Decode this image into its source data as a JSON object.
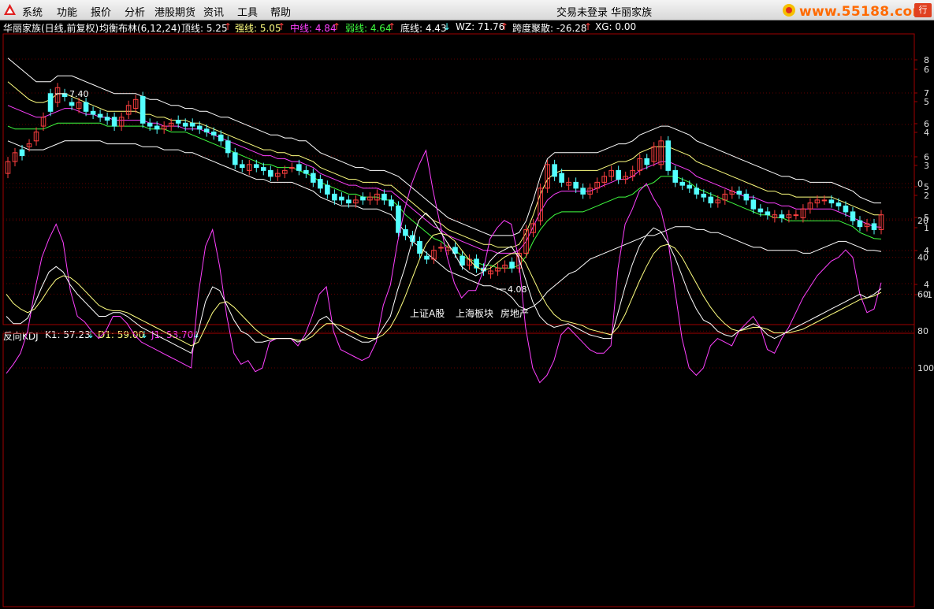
{
  "menu": {
    "items": [
      "系统",
      "功能",
      "报价",
      "分析",
      "港股期货",
      "资讯",
      "工具",
      "帮助"
    ],
    "title": "交易未登录  华丽家族",
    "site": "www.55188.com",
    "corner": "行"
  },
  "main_header": {
    "name": "华丽家族(日线,前复权)",
    "indicator": "均衡布林(6,12,24)",
    "top_label": "顶线: 5.25",
    "strong_label": "强线: 5.05",
    "mid_label": "中线: 4.84",
    "weak_label": "弱线: 4.64",
    "bottom_label": "底线: 4.43",
    "wz_label": "WZ: 71.76",
    "span_label": "跨度聚散: -26.28",
    "xg_label": "XG: 0.00",
    "up_arrow": "↑",
    "down_arrow": "↓"
  },
  "kdj_header": {
    "name": "反向KDJ",
    "k_label": "K1: 57.23",
    "d_label": "D1: 59.00",
    "j_label": "J1: 53.70"
  },
  "annotations": {
    "high": "7.40",
    "low": "4.08"
  },
  "sector_labels": [
    "上证A股",
    "上海板块",
    "房地产"
  ],
  "price_axis_labels": [
    "8",
    "6",
    "7",
    "5",
    "6",
    "4",
    "6",
    "3",
    "5",
    "2",
    "5",
    "1",
    "4",
    "4",
    "-1"
  ],
  "kdj_axis_labels": [
    "100",
    "80",
    "60",
    "40",
    "20",
    "0"
  ],
  "colors": {
    "up": "#ff4040",
    "down": "#54ffff",
    "top": "#ffffff",
    "strong": "#ffff80",
    "mid": "#ff40ff",
    "weak": "#40ff40",
    "bottom": "#ffffff",
    "k": "#ffffff",
    "d": "#ffff80",
    "j": "#ff40ff",
    "frame": "#a00000"
  },
  "chart_data": {
    "type": "candlestick+kdj",
    "price": {
      "close": [
        5.95,
        6.1,
        6.05,
        6.25,
        6.45,
        6.7,
        6.8,
        7.2,
        7.05,
        6.9,
        6.95,
        6.8,
        6.75,
        6.7,
        6.65,
        6.55,
        6.7,
        6.9,
        7.0,
        6.6,
        6.55,
        6.5,
        6.55,
        6.6,
        6.6,
        6.55,
        6.55,
        6.5,
        6.45,
        6.4,
        6.3,
        6.1,
        5.9,
        5.85,
        5.9,
        5.85,
        5.8,
        5.7,
        5.75,
        5.8,
        5.85,
        5.8,
        5.75,
        5.6,
        5.5,
        5.4,
        5.3,
        5.3,
        5.25,
        5.3,
        5.3,
        5.35,
        5.4,
        5.3,
        5.2,
        4.75,
        4.7,
        4.6,
        4.4,
        4.3,
        4.45,
        4.5,
        4.5,
        4.4,
        4.2,
        4.3,
        4.15,
        4.1,
        4.1,
        4.15,
        4.2,
        4.15,
        4.4,
        4.8,
        4.9,
        5.5,
        5.9,
        5.7,
        5.6,
        5.6,
        5.5,
        5.4,
        5.5,
        5.6,
        5.7,
        5.8,
        5.65,
        5.7,
        5.8,
        6.0,
        5.9,
        6.2,
        6.3,
        5.8,
        5.6,
        5.55,
        5.5,
        5.4,
        5.35,
        5.25,
        5.3,
        5.4,
        5.45,
        5.4,
        5.3,
        5.15,
        5.1,
        5.05,
        5.05,
        5.0,
        5.05,
        5.05,
        5.15,
        5.25,
        5.3,
        5.3,
        5.25,
        5.2,
        5.1,
        4.95,
        4.85,
        4.9,
        4.8,
        5.05
      ],
      "open": [
        5.75,
        5.95,
        6.15,
        6.2,
        6.3,
        6.55,
        7.1,
        6.95,
        7.1,
        6.95,
        6.85,
        6.95,
        6.8,
        6.75,
        6.7,
        6.7,
        6.55,
        6.75,
        6.85,
        7.05,
        6.6,
        6.55,
        6.5,
        6.55,
        6.65,
        6.6,
        6.6,
        6.55,
        6.5,
        6.45,
        6.4,
        6.3,
        6.1,
        5.9,
        5.8,
        5.9,
        5.85,
        5.8,
        5.7,
        5.75,
        5.85,
        5.9,
        5.8,
        5.75,
        5.65,
        5.55,
        5.4,
        5.35,
        5.3,
        5.25,
        5.35,
        5.3,
        5.3,
        5.4,
        5.3,
        5.2,
        4.8,
        4.7,
        4.6,
        4.35,
        4.3,
        4.5,
        4.45,
        4.5,
        4.35,
        4.2,
        4.3,
        4.15,
        4.05,
        4.1,
        4.15,
        4.25,
        4.15,
        4.4,
        4.75,
        4.95,
        5.5,
        5.9,
        5.75,
        5.55,
        5.6,
        5.5,
        5.4,
        5.5,
        5.6,
        5.7,
        5.8,
        5.65,
        5.7,
        5.8,
        6.0,
        5.95,
        5.9,
        6.3,
        5.8,
        5.6,
        5.55,
        5.5,
        5.4,
        5.35,
        5.25,
        5.3,
        5.4,
        5.45,
        5.4,
        5.3,
        5.15,
        5.1,
        5.0,
        5.05,
        5.0,
        5.05,
        5.0,
        5.15,
        5.25,
        5.3,
        5.3,
        5.25,
        5.2,
        5.1,
        4.95,
        4.85,
        4.9,
        4.8
      ],
      "bands": {
        "top": [
          7.7,
          7.6,
          7.5,
          7.4,
          7.3,
          7.3,
          7.3,
          7.4,
          7.4,
          7.4,
          7.35,
          7.3,
          7.25,
          7.2,
          7.15,
          7.1,
          7.1,
          7.1,
          7.1,
          7.05,
          7.0,
          7.0,
          6.95,
          6.9,
          6.9,
          6.85,
          6.85,
          6.8,
          6.8,
          6.75,
          6.7,
          6.7,
          6.65,
          6.6,
          6.55,
          6.5,
          6.45,
          6.4,
          6.4,
          6.35,
          6.35,
          6.3,
          6.3,
          6.2,
          6.1,
          6.05,
          6.0,
          5.95,
          5.9,
          5.85,
          5.85,
          5.8,
          5.8,
          5.8,
          5.75,
          5.7,
          5.6,
          5.5,
          5.4,
          5.3,
          5.2,
          5.1,
          5.0,
          4.95,
          4.9,
          4.85,
          4.8,
          4.75,
          4.7,
          4.7,
          4.7,
          4.7,
          4.75,
          4.95,
          5.3,
          5.7,
          6.0,
          6.1,
          6.1,
          6.1,
          6.1,
          6.1,
          6.1,
          6.1,
          6.15,
          6.2,
          6.25,
          6.25,
          6.3,
          6.4,
          6.45,
          6.5,
          6.55,
          6.55,
          6.5,
          6.45,
          6.4,
          6.3,
          6.25,
          6.2,
          6.15,
          6.1,
          6.05,
          6.0,
          5.95,
          5.9,
          5.85,
          5.8,
          5.75,
          5.7,
          5.7,
          5.65,
          5.65,
          5.6,
          5.6,
          5.6,
          5.6,
          5.55,
          5.5,
          5.45,
          5.35,
          5.3,
          5.25,
          5.25
        ],
        "strong": [
          7.3,
          7.2,
          7.1,
          7.0,
          6.95,
          6.95,
          7.0,
          7.1,
          7.1,
          7.05,
          7.0,
          6.95,
          6.9,
          6.85,
          6.8,
          6.8,
          6.8,
          6.8,
          6.8,
          6.75,
          6.75,
          6.7,
          6.7,
          6.65,
          6.65,
          6.65,
          6.6,
          6.6,
          6.55,
          6.5,
          6.45,
          6.4,
          6.35,
          6.3,
          6.25,
          6.2,
          6.15,
          6.15,
          6.1,
          6.1,
          6.05,
          6.05,
          6.0,
          5.95,
          5.85,
          5.8,
          5.75,
          5.7,
          5.65,
          5.65,
          5.6,
          5.6,
          5.6,
          5.55,
          5.55,
          5.45,
          5.35,
          5.25,
          5.15,
          5.05,
          4.95,
          4.9,
          4.8,
          4.75,
          4.7,
          4.65,
          4.6,
          4.55,
          4.55,
          4.5,
          4.5,
          4.5,
          4.55,
          4.75,
          5.05,
          5.4,
          5.65,
          5.75,
          5.8,
          5.8,
          5.8,
          5.8,
          5.8,
          5.8,
          5.85,
          5.9,
          5.95,
          5.95,
          6.0,
          6.1,
          6.15,
          6.2,
          6.2,
          6.2,
          6.15,
          6.1,
          6.05,
          5.95,
          5.9,
          5.85,
          5.8,
          5.75,
          5.7,
          5.65,
          5.6,
          5.55,
          5.5,
          5.45,
          5.45,
          5.4,
          5.4,
          5.35,
          5.35,
          5.35,
          5.35,
          5.35,
          5.35,
          5.3,
          5.25,
          5.2,
          5.15,
          5.1,
          5.05,
          5.05
        ],
        "mid": [
          6.9,
          6.85,
          6.8,
          6.75,
          6.7,
          6.7,
          6.75,
          6.8,
          6.85,
          6.85,
          6.8,
          6.75,
          6.75,
          6.7,
          6.7,
          6.65,
          6.65,
          6.65,
          6.65,
          6.65,
          6.6,
          6.6,
          6.55,
          6.55,
          6.55,
          6.5,
          6.5,
          6.5,
          6.45,
          6.4,
          6.35,
          6.3,
          6.25,
          6.2,
          6.15,
          6.1,
          6.05,
          6.05,
          6.0,
          6.0,
          5.95,
          5.95,
          5.9,
          5.85,
          5.75,
          5.7,
          5.65,
          5.6,
          5.55,
          5.55,
          5.5,
          5.5,
          5.5,
          5.45,
          5.45,
          5.35,
          5.25,
          5.15,
          5.05,
          4.95,
          4.85,
          4.8,
          4.7,
          4.65,
          4.6,
          4.55,
          4.5,
          4.45,
          4.45,
          4.4,
          4.4,
          4.4,
          4.45,
          4.6,
          4.85,
          5.1,
          5.3,
          5.4,
          5.45,
          5.45,
          5.45,
          5.45,
          5.45,
          5.5,
          5.55,
          5.6,
          5.65,
          5.65,
          5.7,
          5.8,
          5.85,
          5.9,
          5.95,
          5.95,
          5.9,
          5.85,
          5.8,
          5.7,
          5.65,
          5.6,
          5.55,
          5.5,
          5.45,
          5.4,
          5.35,
          5.35,
          5.3,
          5.25,
          5.25,
          5.2,
          5.2,
          5.15,
          5.15,
          5.15,
          5.15,
          5.15,
          5.15,
          5.1,
          5.05,
          5.0,
          4.95,
          4.9,
          4.85,
          4.84
        ],
        "weak": [
          6.55,
          6.5,
          6.5,
          6.5,
          6.5,
          6.5,
          6.55,
          6.6,
          6.6,
          6.6,
          6.6,
          6.6,
          6.6,
          6.6,
          6.55,
          6.55,
          6.55,
          6.55,
          6.55,
          6.55,
          6.5,
          6.5,
          6.5,
          6.45,
          6.45,
          6.45,
          6.4,
          6.35,
          6.3,
          6.25,
          6.2,
          6.15,
          6.1,
          6.05,
          6.0,
          5.95,
          5.9,
          5.9,
          5.85,
          5.85,
          5.85,
          5.8,
          5.75,
          5.7,
          5.6,
          5.55,
          5.5,
          5.45,
          5.4,
          5.4,
          5.35,
          5.35,
          5.35,
          5.3,
          5.3,
          5.2,
          5.05,
          4.95,
          4.85,
          4.75,
          4.65,
          4.6,
          4.5,
          4.45,
          4.35,
          4.3,
          4.25,
          4.2,
          4.2,
          4.15,
          4.15,
          4.15,
          4.2,
          4.35,
          4.6,
          4.8,
          4.95,
          5.05,
          5.1,
          5.1,
          5.1,
          5.1,
          5.15,
          5.2,
          5.25,
          5.3,
          5.35,
          5.35,
          5.4,
          5.5,
          5.55,
          5.6,
          5.7,
          5.7,
          5.7,
          5.65,
          5.6,
          5.5,
          5.45,
          5.4,
          5.35,
          5.3,
          5.25,
          5.2,
          5.15,
          5.1,
          5.05,
          5.05,
          5.0,
          5.0,
          4.95,
          4.95,
          4.95,
          4.95,
          4.95,
          4.95,
          4.95,
          4.95,
          4.9,
          4.85,
          4.75,
          4.7,
          4.65,
          4.64
        ],
        "bottom": [
          6.3,
          6.25,
          6.2,
          6.15,
          6.15,
          6.15,
          6.2,
          6.25,
          6.3,
          6.3,
          6.3,
          6.3,
          6.3,
          6.3,
          6.25,
          6.25,
          6.25,
          6.25,
          6.25,
          6.2,
          6.2,
          6.2,
          6.15,
          6.15,
          6.15,
          6.1,
          6.1,
          6.05,
          6.0,
          5.95,
          5.9,
          5.85,
          5.8,
          5.75,
          5.7,
          5.65,
          5.65,
          5.6,
          5.6,
          5.6,
          5.6,
          5.55,
          5.5,
          5.45,
          5.35,
          5.3,
          5.25,
          5.2,
          5.2,
          5.2,
          5.15,
          5.15,
          5.15,
          5.1,
          5.05,
          4.9,
          4.75,
          4.6,
          4.5,
          4.4,
          4.3,
          4.2,
          4.1,
          4.05,
          4.0,
          3.95,
          3.9,
          3.85,
          3.85,
          3.8,
          3.75,
          3.65,
          3.5,
          3.45,
          3.5,
          3.6,
          3.75,
          3.85,
          3.95,
          4.05,
          4.1,
          4.2,
          4.3,
          4.35,
          4.4,
          4.45,
          4.5,
          4.55,
          4.6,
          4.65,
          4.7,
          4.7,
          4.75,
          4.8,
          4.85,
          4.85,
          4.85,
          4.8,
          4.8,
          4.75,
          4.75,
          4.7,
          4.65,
          4.6,
          4.55,
          4.5,
          4.5,
          4.45,
          4.45,
          4.45,
          4.45,
          4.45,
          4.4,
          4.4,
          4.45,
          4.5,
          4.55,
          4.6,
          4.6,
          4.55,
          4.5,
          4.45,
          4.45,
          4.43
        ]
      },
      "y_range": [
        3.3,
        7.95
      ]
    },
    "kdj": {
      "k": [
        72,
        76,
        76,
        73,
        65,
        56,
        48,
        45,
        48,
        55,
        60,
        64,
        68,
        72,
        72,
        70,
        70,
        72,
        75,
        78,
        80,
        82,
        84,
        86,
        88,
        90,
        92,
        80,
        64,
        56,
        58,
        66,
        74,
        80,
        82,
        86,
        86,
        85,
        84,
        84,
        84,
        86,
        84,
        80,
        74,
        72,
        76,
        80,
        82,
        84,
        86,
        86,
        84,
        78,
        72,
        58,
        46,
        32,
        20,
        16,
        20,
        26,
        32,
        38,
        45,
        48,
        50,
        48,
        42,
        38,
        36,
        34,
        40,
        52,
        64,
        72,
        76,
        78,
        77,
        76,
        78,
        80,
        82,
        83,
        84,
        84,
        70,
        56,
        44,
        34,
        28,
        24,
        26,
        32,
        40,
        50,
        60,
        68,
        74,
        76,
        80,
        82,
        83,
        80,
        78,
        76,
        78,
        82,
        84,
        82,
        80,
        78,
        76,
        74,
        72,
        70,
        68,
        66,
        64,
        62,
        60,
        62,
        60,
        57
      ],
      "d": [
        60,
        65,
        68,
        70,
        68,
        63,
        57,
        52,
        50,
        51,
        54,
        58,
        62,
        66,
        68,
        69,
        69,
        70,
        72,
        74,
        76,
        78,
        80,
        82,
        84,
        86,
        88,
        86,
        78,
        70,
        65,
        64,
        67,
        71,
        75,
        79,
        82,
        84,
        84,
        84,
        84,
        85,
        85,
        83,
        79,
        76,
        76,
        77,
        79,
        81,
        83,
        84,
        84,
        82,
        78,
        71,
        62,
        52,
        42,
        33,
        28,
        27,
        28,
        31,
        36,
        41,
        45,
        47,
        46,
        43,
        40,
        38,
        38,
        43,
        51,
        59,
        66,
        71,
        74,
        75,
        76,
        77,
        79,
        80,
        81,
        82,
        78,
        71,
        62,
        53,
        45,
        38,
        34,
        33,
        35,
        40,
        47,
        54,
        61,
        67,
        72,
        76,
        79,
        80,
        79,
        78,
        78,
        79,
        81,
        81,
        81,
        80,
        79,
        77,
        75,
        73,
        71,
        69,
        67,
        65,
        63,
        62,
        61,
        59
      ],
      "j": [
        103,
        98,
        92,
        80,
        58,
        40,
        30,
        22,
        32,
        58,
        72,
        75,
        80,
        84,
        80,
        72,
        72,
        76,
        82,
        86,
        88,
        90,
        92,
        94,
        96,
        98,
        100,
        60,
        34,
        25,
        45,
        72,
        92,
        98,
        96,
        102,
        100,
        86,
        84,
        84,
        84,
        88,
        82,
        72,
        60,
        56,
        80,
        90,
        92,
        94,
        96,
        94,
        86,
        66,
        55,
        32,
        14,
        0,
        -10,
        -18,
        4,
        22,
        40,
        54,
        62,
        58,
        58,
        48,
        30,
        24,
        20,
        22,
        40,
        78,
        100,
        108,
        104,
        96,
        82,
        78,
        82,
        86,
        90,
        92,
        92,
        88,
        46,
        22,
        14,
        4,
        0,
        8,
        14,
        30,
        58,
        84,
        100,
        104,
        100,
        88,
        84,
        86,
        88,
        80,
        76,
        72,
        78,
        90,
        92,
        84,
        78,
        70,
        62,
        56,
        50,
        46,
        42,
        40,
        36,
        40,
        60,
        70,
        68,
        53.7
      ]
    }
  }
}
